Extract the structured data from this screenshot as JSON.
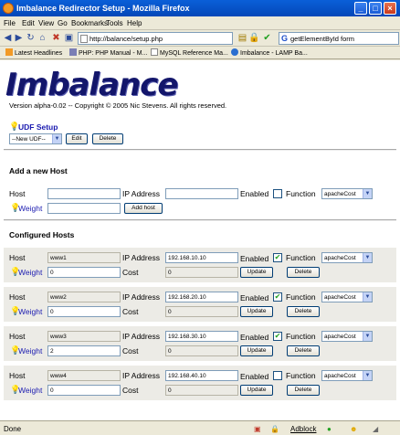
{
  "window": {
    "title": "Imbalance Redirector Setup - Mozilla Firefox"
  },
  "menu": [
    "File",
    "Edit",
    "View",
    "Go",
    "Bookmarks",
    "Tools",
    "Help"
  ],
  "nav": {
    "url": "http://balance/setup.php",
    "search_value": "getElementById form"
  },
  "bookmarks": [
    "Latest Headlines",
    "PHP: PHP Manual - M...",
    "MySQL Reference Ma...",
    "Imbalance - LAMP Ba..."
  ],
  "page": {
    "logo": "Imbalance",
    "version": "Version alpha-0.02 -- Copyright © 2005 Nic Stevens. All rights reserved.",
    "udf": {
      "title": "UDF Setup",
      "select_value": "--New UDF--",
      "edit_label": "Edit",
      "delete_label": "Delete"
    },
    "add_host": {
      "heading": "Add a new Host",
      "host_label": "Host",
      "ip_label": "IP Address",
      "enabled_label": "Enabled",
      "function_label": "Function",
      "function_value": "apacheCost",
      "weight_label": "Weight",
      "add_button": "Add host"
    },
    "configured": {
      "heading": "Configured Hosts",
      "labels": {
        "host": "Host",
        "ip": "IP Address",
        "enabled": "Enabled",
        "function": "Function",
        "weight": "Weight",
        "cost": "Cost",
        "update": "Update",
        "delete": "Delete"
      },
      "hosts": [
        {
          "host": "www1",
          "ip": "192.168.10.10",
          "enabled": true,
          "function": "apacheCost",
          "weight": "0",
          "cost": "0"
        },
        {
          "host": "www2",
          "ip": "192.168.20.10",
          "enabled": true,
          "function": "apacheCost",
          "weight": "0",
          "cost": "0"
        },
        {
          "host": "www3",
          "ip": "192.168.30.10",
          "enabled": true,
          "function": "apacheCost",
          "weight": "2",
          "cost": "0"
        },
        {
          "host": "www4",
          "ip": "192.168.40.10",
          "enabled": false,
          "function": "apacheCost",
          "weight": "0",
          "cost": "0"
        }
      ]
    }
  },
  "status": {
    "text": "Done",
    "adblock": "Adblock"
  },
  "colors": {
    "titlebar": "#0a5fd8",
    "link": "#1b1bb0",
    "logo": "#13166b"
  }
}
